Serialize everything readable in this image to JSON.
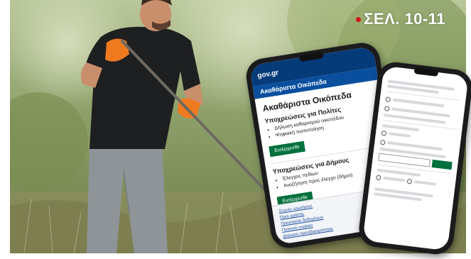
{
  "badge": {
    "text": "ΣΕΛ. 10-11",
    "dot_color": "#d0141c"
  },
  "phone_main": {
    "logo": "gov.gr",
    "subtitle": "Ακαθάριστα Οικόπεδα",
    "title": "Ακαθάριστα Οικόπεδα",
    "section1": {
      "heading": "Υποχρεώσεις για Πολίτες",
      "items": [
        "Δήλωση καθαρισμού οικοπέδου",
        "Ψηφιακή πιστοποίηση"
      ],
      "button": "Εισέρχεσθε"
    },
    "section2": {
      "heading": "Υποχρεώσεις για Δήμους",
      "items": [
        "Έλεγχος πεδίων",
        "Αναζήτηση προς έλεγχο (δήμοι)"
      ],
      "button": "Εισέρχεσθε"
    },
    "footer_links": [
      "Συχνές ερωτήσεις",
      "Όροι χρήσης",
      "Προστασία δεδομένων",
      "Πολιτική cookies",
      "Δήλωση προσβασιμότητας"
    ]
  },
  "phone_secondary": {
    "button_color": "#00703c"
  },
  "colors": {
    "gov_blue": "#063b7a",
    "gov_green": "#00703c"
  }
}
